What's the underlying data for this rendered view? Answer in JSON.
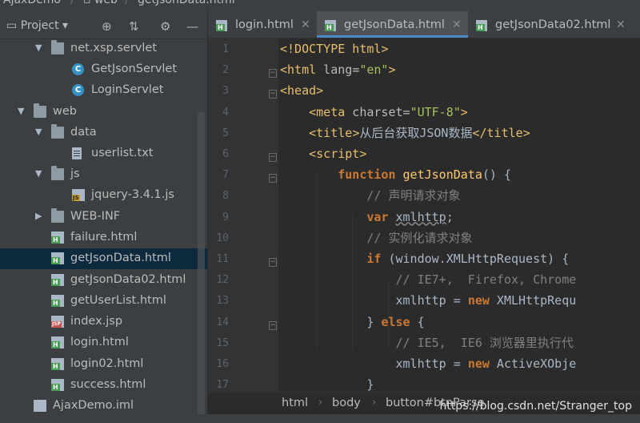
{
  "titlebar": {
    "project": "AjaxDemo",
    "folder": "web",
    "file": "getJsonData.html"
  },
  "project_panel": {
    "title": "Project",
    "icons": [
      "globe-icon",
      "collapse-icon",
      "gear-icon",
      "minimize-icon"
    ],
    "tree": [
      {
        "label": "net.xsp.servlet",
        "icon": "package-folder",
        "expanded": true
      },
      {
        "label": "GetJsonServlet",
        "icon": "class"
      },
      {
        "label": "LoginServlet",
        "icon": "class"
      },
      {
        "label": "web",
        "icon": "web-folder",
        "expanded": true
      },
      {
        "label": "data",
        "icon": "folder",
        "expanded": true
      },
      {
        "label": "userlist.txt",
        "icon": "text-file"
      },
      {
        "label": "js",
        "icon": "folder",
        "expanded": true
      },
      {
        "label": "jquery-3.4.1.js",
        "icon": "js-file"
      },
      {
        "label": "WEB-INF",
        "icon": "folder",
        "expanded": false
      },
      {
        "label": "failure.html",
        "icon": "html-file"
      },
      {
        "label": "getJsonData.html",
        "icon": "html-file",
        "selected": true
      },
      {
        "label": "getJsonData02.html",
        "icon": "html-file"
      },
      {
        "label": "getUserList.html",
        "icon": "html-file"
      },
      {
        "label": "index.jsp",
        "icon": "jsp-file"
      },
      {
        "label": "login.html",
        "icon": "html-file"
      },
      {
        "label": "login02.html",
        "icon": "html-file"
      },
      {
        "label": "success.html",
        "icon": "html-file"
      },
      {
        "label": "AjaxDemo.iml",
        "icon": "iml-file"
      }
    ]
  },
  "tabs": [
    {
      "label": "login.html",
      "active": false
    },
    {
      "label": "getJsonData.html",
      "active": true
    },
    {
      "label": "getJsonData02.html",
      "active": false
    }
  ],
  "editor": {
    "line_numbers": [
      "1",
      "2",
      "3",
      "4",
      "5",
      "6",
      "7",
      "8",
      "9",
      "10",
      "11",
      "12",
      "13",
      "14",
      "15",
      "16",
      "17"
    ],
    "lines": [
      "<!DOCTYPE html>",
      "<html lang=\"en\">",
      "<head>",
      "    <meta charset=\"UTF-8\">",
      "    <title>从后台获取JSON数据</title>",
      "    <script>",
      "        function getJsonData() {",
      "            // 声明请求对象",
      "            var xmlhttp;",
      "            // 实例化请求对象",
      "            if (window.XMLHttpRequest) {",
      "                // IE7+,  Firefox, Chrome",
      "                xmlhttp = new XMLHttpRequ",
      "            } else {",
      "                // IE5,  IE6 浏览器里执行代",
      "                xmlhttp = new ActiveXObje",
      "            }"
    ]
  },
  "breadcrumb": [
    "html",
    "body",
    "button#btnParse"
  ],
  "watermark": "https://blog.csdn.net/Stranger_top",
  "colors": {
    "accent": "#4a88c7",
    "selection": "#0d293e",
    "tag": "#e8bf6a",
    "string": "#a5c25c",
    "keyword": "#cc7832"
  }
}
